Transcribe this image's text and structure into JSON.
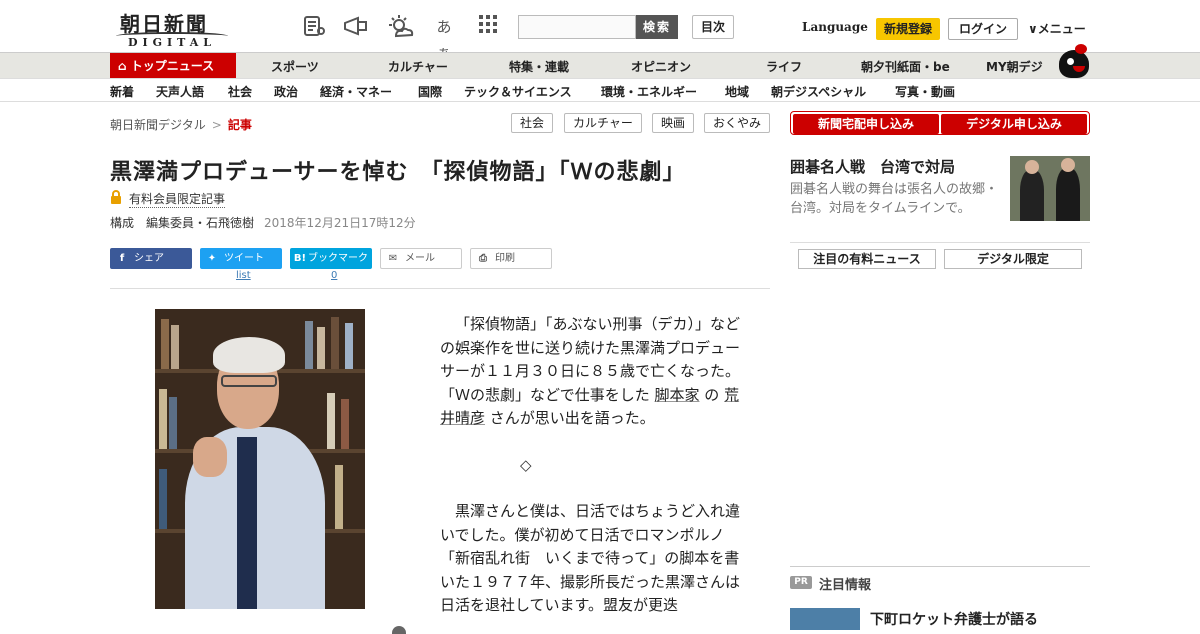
{
  "header": {
    "logo_jp": "朝日新聞",
    "logo_en": "DIGITAL",
    "icons": [
      "newspaper-icon",
      "megaphone-icon",
      "weather-icon",
      "font-size-icon",
      "grid-icon"
    ],
    "font_icon_text": "あぁ",
    "search_button": "検索",
    "contents_button": "目次",
    "language": "Language",
    "register": "新規登録",
    "login": "ログイン",
    "menu": "メニュー"
  },
  "nav_primary": [
    "トップニュース",
    "スポーツ",
    "カルチャー",
    "特集・連載",
    "オピニオン",
    "ライフ",
    "朝夕刊紙面・be",
    "MY朝デジ"
  ],
  "nav_secondary": [
    "新着",
    "天声人語",
    "社会",
    "政治",
    "経済・マネー",
    "国際",
    "テック＆サイエンス",
    "環境・エネルギー",
    "地域",
    "朝デジスペシャル",
    "写真・動画"
  ],
  "breadcrumb": {
    "home": "朝日新聞デジタル",
    "sep": ">",
    "current": "記事"
  },
  "tags": [
    "社会",
    "カルチャー",
    "映画",
    "おくやみ"
  ],
  "article": {
    "title": "黒澤満プロデューサーを悼む　「探偵物語」「Ｗの悲劇」",
    "paid_label": "有料会員限定記事",
    "byline": "構成　編集委員・石飛徳樹",
    "date": "2018年12月21日17時12分",
    "para1_a": "「探偵物語」「あぶない刑事（デカ）」などの娯楽作を世に送り続けた黒澤満プロデューサーが１１月３０日に８５歳で亡くなった。「Ｗの悲劇」などで仕事をした",
    "para1_link1": "脚本家",
    "para1_b": "の",
    "para1_link2": "荒井晴彦",
    "para1_c": "さんが思い出を語った。",
    "divider": "◇",
    "para2": "黒澤さんと僕は、日活ではちょうど入れ違いでした。僕が初めて日活でロマンポルノ「新宿乱れ街　いくまで待って」の脚本を書いた１９７７年、撮影所長だった黒澤さんは日活を退社しています。盟友が更迭"
  },
  "share": {
    "facebook": "シェア",
    "twitter": "ツイート",
    "twitter_count": "list",
    "hatena": "ブックマーク",
    "hatena_count": "0",
    "mail": "メール",
    "print": "印刷"
  },
  "sidebar": {
    "subscribe_paper": "新聞宅配申し込み",
    "subscribe_digital": "デジタル申し込み",
    "feature_title": "囲碁名人戦　台湾で対局",
    "feature_desc": "囲碁名人戦の舞台は張名人の故郷・台湾。対局をタイムラインで。",
    "tab_paid": "注目の有料ニュース",
    "tab_digital": "デジタル限定",
    "pr_badge": "PR",
    "pr_title": "注目情報",
    "pr_item": "下町ロケット弁護士が語る"
  },
  "colors": {
    "brand_red": "#cc0000",
    "register_yellow": "#f7c600",
    "nav_bg": "#e6e6e1"
  }
}
